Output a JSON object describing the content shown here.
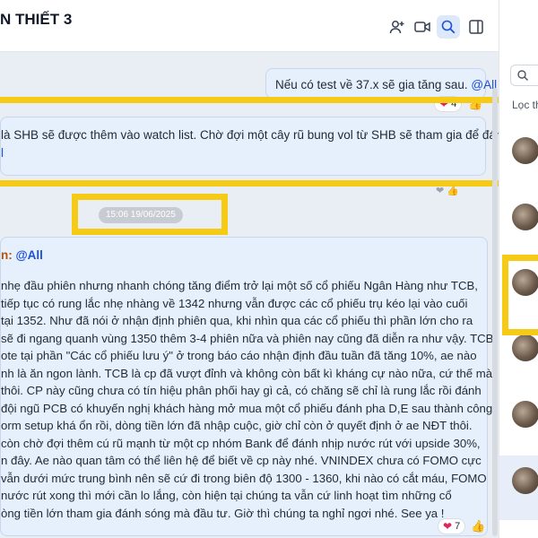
{
  "header": {
    "title": "N THIẾT 3",
    "icons": [
      "add-member-icon",
      "video-call-icon",
      "search-icon",
      "sidebar-toggle-icon"
    ]
  },
  "messages": {
    "msg1": {
      "text": "Nếu có test về 37.x sẽ gia tăng sau. ",
      "mention": "@All",
      "reaction_count": "4"
    },
    "msg2": {
      "line1": "là SHB sẽ được thêm vào watch list. Chờ đợi một cây rũ bung vol từ SHB sẽ tham gia để đánh",
      "line2": "l"
    },
    "timestamp": "15:06 19/06/2025",
    "msg3": {
      "sender_prefix": "n: ",
      "mention": "@All",
      "lines": [
        "nhẹ đầu phiên nhưng nhanh chóng tăng điểm trở lại một số cổ phiếu Ngân Hàng như TCB,",
        "tiếp tục có rung lắc nhẹ nhàng về 1342 nhưng vẫn được các cổ phiếu trụ kéo lại vào cuối",
        "tại 1352. Như đã nói ở nhận định phiên qua, khi nhìn qua các cổ phiếu thì phần lớn cho ra",
        "sẽ đi ngang quanh vùng 1350 thêm 3-4 phiên nữa và phiên nay cũng đã diễn ra như vậy. TCB",
        "ote tại phần \"Các cổ phiếu lưu ý\" ở trong báo cáo nhận định đầu tuần đã tăng 10%, ae nào",
        "nh là ăn ngon lành. TCB là cp đã vượt đỉnh và không còn bất kì kháng cự nào nữa, cứ thế mà",
        "thôi. CP này cũng chưa có tín hiệu phân phối hay gì cả, có chăng sẽ chỉ là rung lắc rồi đánh",
        "đội ngũ PCB có khuyến nghị khách hàng mở mua một cổ phiếu đánh pha D,E sau thành công",
        "orm setup khá ổn rồi, dòng tiền lớn đã nhập cuộc, giờ chỉ còn ở quyết định ở ae NĐT thôi.",
        "còn chờ đợi thêm cú rũ mạnh từ một cp nhóm Bank để đánh nhịp nước rút với upside 30%,",
        "n đây. Ae nào quan tâm có thể liên hệ để biết về cp này nhé. VNINDEX chưa có FOMO cực",
        "vẫn dưới mức trung bình nên sẽ cứ đi trong biên độ 1300 - 1360, khi nào có cắt máu, FOMO",
        "nước rút xong thì mới cần lo lắng, còn hiện tại chúng ta vẫn cứ linh hoạt tìm những cổ",
        "òng tiền lớn tham gia đánh sóng mà đầu tư. Giờ thì chúng ta nghỉ ngơi nhé. See ya !"
      ],
      "reaction_count": "7"
    }
  },
  "right_panel": {
    "search_icon": "search-icon",
    "filter_label": "Lọc th"
  },
  "colors": {
    "highlight": "#f6cb16",
    "bubble": "#e6f0fd",
    "mention": "#1d4fd8"
  }
}
